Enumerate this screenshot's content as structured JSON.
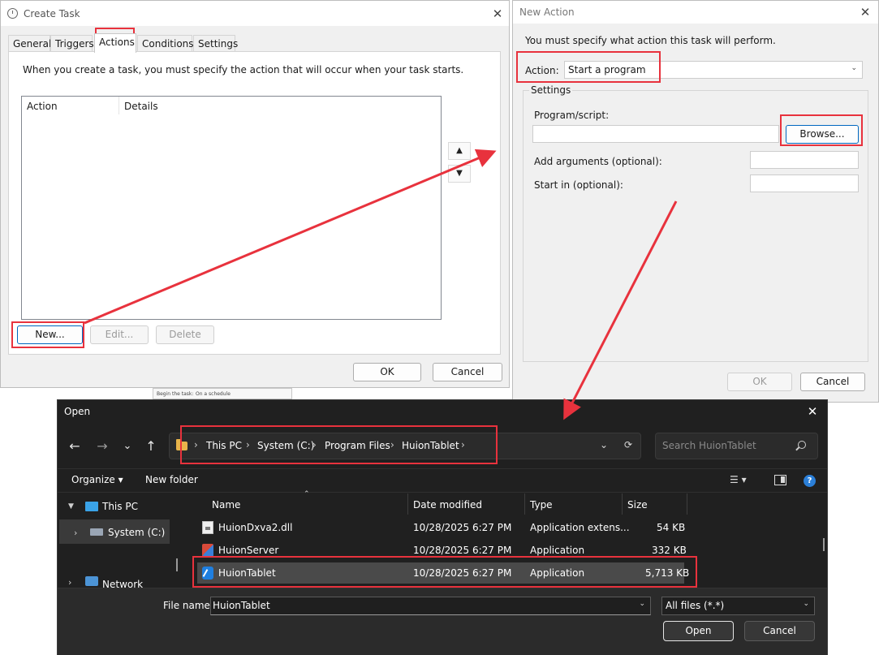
{
  "create_task": {
    "title": "Create Task",
    "close": "✕",
    "tabs": [
      "General",
      "Triggers",
      "Actions",
      "Conditions",
      "Settings"
    ],
    "active_tab": "Actions",
    "description": "When you create a task, you must specify the action that will occur when your task starts.",
    "columns": [
      "Action",
      "Details"
    ],
    "move_up": "▲",
    "move_down": "▼",
    "buttons": {
      "new": "New...",
      "edit": "Edit...",
      "delete": "Delete",
      "ok": "OK",
      "cancel": "Cancel"
    }
  },
  "new_action": {
    "title": "New Action",
    "close": "✕",
    "info": "You must specify what action this task will perform.",
    "action_label": "Action:",
    "action_value": "Start a program",
    "settings_label": "Settings",
    "program_label": "Program/script:",
    "program_value": "",
    "browse": "Browse...",
    "arguments_label": "Add arguments (optional):",
    "start_in_label": "Start in (optional):",
    "ok": "OK",
    "cancel": "Cancel"
  },
  "open_dialog": {
    "title": "Open",
    "close": "✕",
    "nav": {
      "back": "←",
      "forward": "→",
      "recent": "⌄",
      "up": "↑"
    },
    "breadcrumb": [
      "This PC",
      "System (C:)",
      "Program Files",
      "HuionTablet"
    ],
    "search_placeholder": "Search HuionTablet",
    "toolbar": {
      "organize": "Organize ▾",
      "new_folder": "New folder"
    },
    "tree": [
      {
        "label": "This PC",
        "expanded": true
      },
      {
        "label": "System (C:)",
        "selected": true
      },
      {
        "label": "Network",
        "expanded": false
      }
    ],
    "columns": [
      "Name",
      "Date modified",
      "Type",
      "Size"
    ],
    "files": [
      {
        "name": "HuionDxva2.dll",
        "date": "10/28/2025 6:27 PM",
        "type": "Application extens...",
        "size": "54 KB",
        "icon": "dll-icon"
      },
      {
        "name": "HuionServer",
        "date": "10/28/2025 6:27 PM",
        "type": "Application",
        "size": "332 KB",
        "icon": "app-icon"
      },
      {
        "name": "HuionTablet",
        "date": "10/28/2025 6:27 PM",
        "type": "Application",
        "size": "5,713 KB",
        "icon": "huion-tablet-icon"
      }
    ],
    "selected_file": "HuionTablet",
    "file_name_label": "File name:",
    "file_name_value": "HuionTablet",
    "filter": "All files (*.*)",
    "open": "Open",
    "cancel": "Cancel"
  },
  "background_window": {
    "label1": "Begin the task:",
    "label2": "On a schedule"
  },
  "colors": {
    "annotation": "#e8323d",
    "accent": "#0067c0",
    "dark_bg": "#202020"
  }
}
